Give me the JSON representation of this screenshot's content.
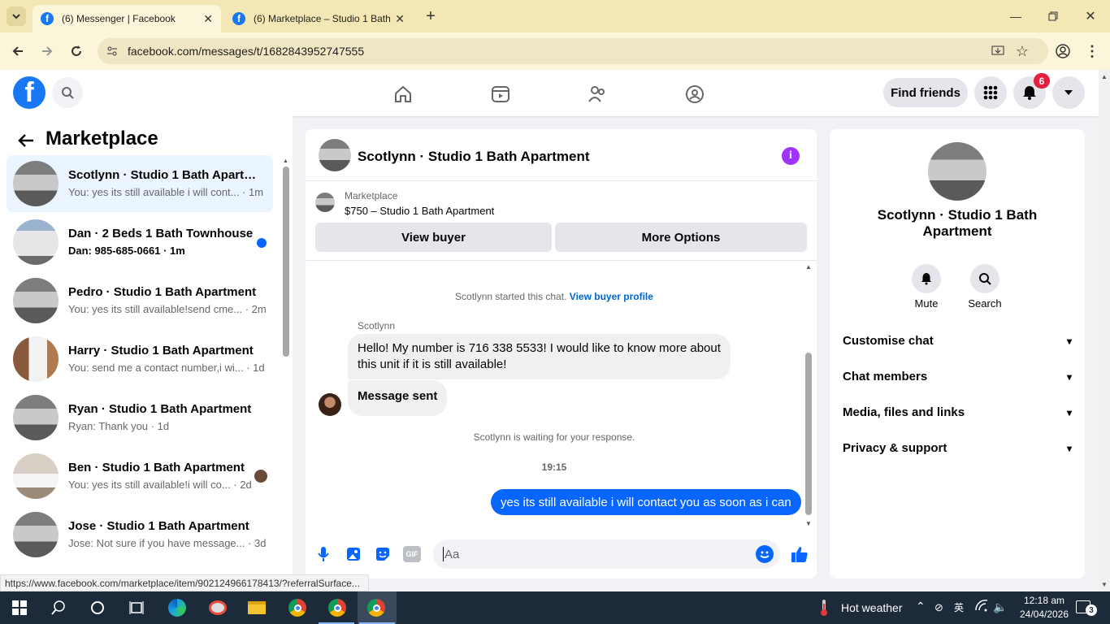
{
  "browser": {
    "tabs": [
      {
        "title": "(6) Messenger | Facebook",
        "active": true
      },
      {
        "title": "(6) Marketplace – Studio 1 Bath",
        "active": false
      }
    ],
    "url": "facebook.com/messages/t/1682843952747555",
    "status_url": "https://www.facebook.com/marketplace/item/902124966178413/?referralSurface..."
  },
  "fb_header": {
    "find_friends": "Find friends",
    "notification_count": "6"
  },
  "marketplace": {
    "title": "Marketplace",
    "conversations": [
      {
        "name": "Scotlynn · Studio 1 Bath Apartm...",
        "preview": "You: yes its still available i will cont... · 1m",
        "selected": true,
        "unread": false
      },
      {
        "name": "Dan · 2 Beds 1 Bath Townhouse",
        "preview": "Dan: 985-685-0661 · 1m",
        "selected": false,
        "unread": true
      },
      {
        "name": "Pedro · Studio 1 Bath Apartment",
        "preview": "You: yes its still available!send cme... · 2m",
        "selected": false,
        "unread": false
      },
      {
        "name": "Harry · Studio 1 Bath Apartment",
        "preview": "You: send me a contact number,i wi... · 1d",
        "selected": false,
        "unread": false
      },
      {
        "name": "Ryan · Studio 1 Bath Apartment",
        "preview": "Ryan: Thank you · 1d",
        "selected": false,
        "unread": false
      },
      {
        "name": "Ben · Studio 1 Bath Apartment",
        "preview": "You: yes its still available!i will co... · 2d",
        "selected": false,
        "unread": false
      },
      {
        "name": "Jose · Studio 1 Bath Apartment",
        "preview": "Jose: Not sure if you have message... · 3d",
        "selected": false,
        "unread": false
      }
    ]
  },
  "chat": {
    "title": "Scotlynn · Studio 1 Bath Apartment",
    "listing_label": "Marketplace",
    "listing_title": "$750 – Studio 1 Bath Apartment",
    "view_buyer": "View buyer",
    "more_options": "More Options",
    "started_text": "Scotlynn started this chat.",
    "view_buyer_profile": "View buyer profile",
    "sender_name": "Scotlynn",
    "incoming_message": "Hello! My number is 716 338 5533! I would like to know more about this unit if it is still available!",
    "message_sent": "Message sent",
    "waiting_text": "Scotlynn is waiting for your response.",
    "time": "19:15",
    "outgoing_message": "yes its still available i will contact you as soon as i can",
    "input_placeholder": "Aa"
  },
  "info_panel": {
    "name": "Scotlynn · Studio 1 Bath Apartment",
    "mute": "Mute",
    "search": "Search",
    "sections": [
      "Customise chat",
      "Chat members",
      "Media, files and links",
      "Privacy & support"
    ]
  },
  "taskbar": {
    "weather": "Hot weather",
    "time": "12:18 am",
    "date": "24/04/2026",
    "notif_count": "3"
  },
  "colors": {
    "fb_blue": "#1877f2",
    "chat_purple": "#a033ff",
    "outgoing_bubble": "#0866ff"
  }
}
